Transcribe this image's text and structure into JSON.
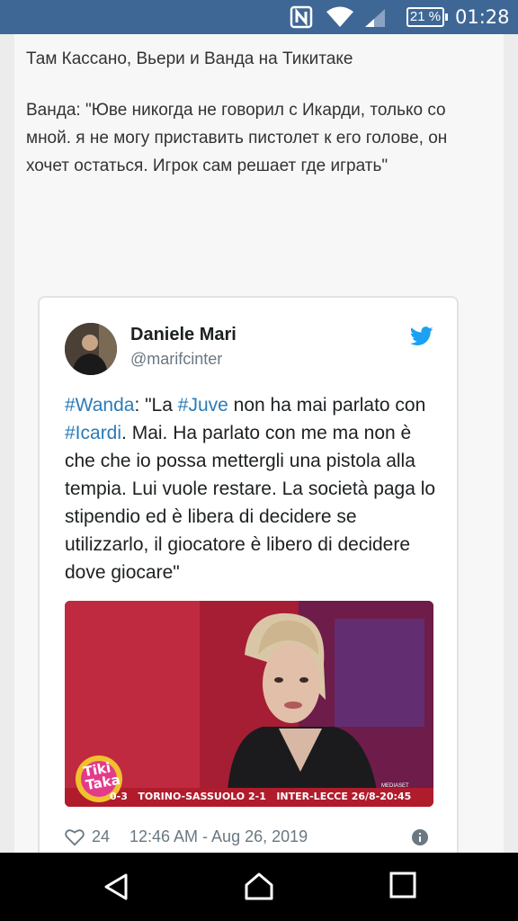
{
  "status_bar": {
    "battery": "21 %",
    "time": "01:28",
    "icons": [
      "nfc-icon",
      "wifi-icon",
      "signal-icon",
      "battery-icon"
    ]
  },
  "post": {
    "line1": "Там Кассано, Вьери и Ванда на Тикитаке",
    "line2": "Ванда: \"Юве никогда не говорил с Икарди, только со мной. я не могу приставить пистолет к его голове, он хочет остаться. Игрок сам решает где играть\""
  },
  "tweet": {
    "author_name": "Daniele Mari",
    "author_handle": "@marifcinter",
    "hashtags": [
      "#Wanda",
      "#Juve",
      "#Icardi"
    ],
    "text_part1": ": \"La ",
    "text_part2": " non ha mai parlato con ",
    "text_part3": ". Mai. Ha parlato con me ma non è che che io possa mettergli una pistola alla tempia. Lui vuole restare. La società paga lo stipendio ed è libera di decidere se utilizzarlo, il giocatore è libero di decidere dove giocare\"",
    "likes": "24",
    "timestamp": "12:46 AM - Aug 26, 2019",
    "media": {
      "logo_line1": "Tiki",
      "logo_line2": "Taka",
      "ticker": "0-3   TORINO-SASSUOLO 2-1   INTER-LECCE 26/8-20:45",
      "channel": "MEDIASET"
    }
  },
  "colors": {
    "status_bar": "#3e6796",
    "link": "#2b7bb9",
    "twitter_blue": "#1da1f2"
  }
}
